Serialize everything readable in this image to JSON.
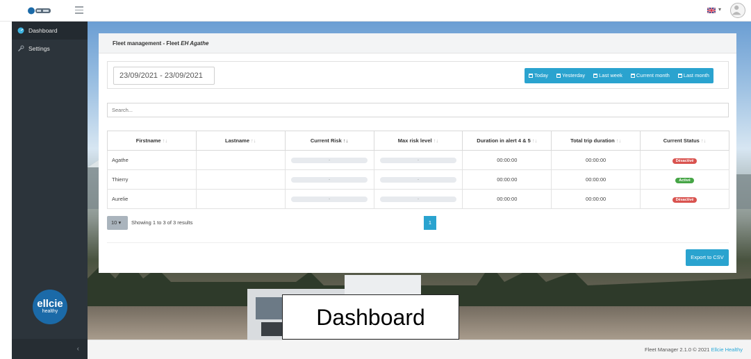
{
  "topbar": {
    "logo_icon": "ellcie-logo-icon",
    "menu_icon": "hamburger-icon",
    "lang_flag": "uk-flag-icon",
    "lang_caret": "▾",
    "avatar_icon": "user-avatar-icon"
  },
  "sidebar": {
    "items": [
      {
        "label": "Dashboard",
        "icon": "dashboard-icon",
        "active": true
      },
      {
        "label": "Settings",
        "icon": "wrench-icon",
        "active": false
      }
    ],
    "brand_line1": "ellcie",
    "brand_line2": "healthy",
    "collapse_glyph": "‹"
  },
  "card": {
    "title_prefix": "Fleet management - Fleet ",
    "title_fleet": "EH Agathe"
  },
  "filters": {
    "date_range": "23/09/2021 - 23/09/2021",
    "quick_ranges": [
      "Today",
      "Yesterday",
      "Last week",
      "Current month",
      "Last month"
    ]
  },
  "search": {
    "placeholder": "Search..."
  },
  "table": {
    "columns": [
      "Firstname",
      "Lastname",
      "Current Risk",
      "Max risk level",
      "Duration in alert 4 & 5",
      "Total trip duration",
      "Current Status"
    ],
    "sort_glyph": "↑↓",
    "rows": [
      {
        "firstname": "Agathe",
        "lastname": "",
        "current_risk": "-",
        "max_risk": "-",
        "duration_alert": "00:00:00",
        "total_duration": "00:00:00",
        "status": "Désactivé",
        "status_kind": "off"
      },
      {
        "firstname": "Thierry",
        "lastname": "",
        "current_risk": "-",
        "max_risk": "-",
        "duration_alert": "00:00:00",
        "total_duration": "00:00:00",
        "status": "Activé",
        "status_kind": "on"
      },
      {
        "firstname": "Aurelie",
        "lastname": "",
        "current_risk": "-",
        "max_risk": "-",
        "duration_alert": "00:00:00",
        "total_duration": "00:00:00",
        "status": "Désactivé",
        "status_kind": "off"
      }
    ]
  },
  "pagination": {
    "page_size": "10",
    "page_size_caret": "▾",
    "showing": "Showing 1 to 3 of 3 results",
    "current_page": "1"
  },
  "actions": {
    "export_label": "Export to CSV"
  },
  "footer": {
    "text": "Fleet Manager 2.1.0 © 2021 ",
    "link": "Ellcie Healthy"
  },
  "caption": "Dashboard",
  "colors": {
    "accent": "#2aa3cf",
    "sidebar_bg": "#2c343b",
    "status_off": "#d9534f",
    "status_on": "#46a546"
  }
}
